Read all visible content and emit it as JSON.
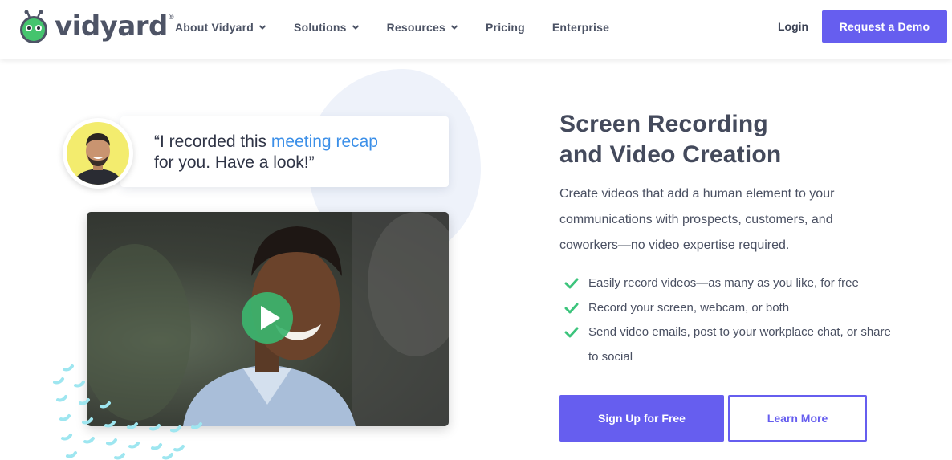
{
  "header": {
    "logo_text": "vidyard",
    "logo_mark": "®",
    "nav": [
      {
        "label": "About Vidyard",
        "icon": "chevron-down-icon"
      },
      {
        "label": "Solutions",
        "icon": "chevron-down-icon"
      },
      {
        "label": "Resources",
        "icon": "chevron-down-icon"
      },
      {
        "label": "Pricing"
      },
      {
        "label": "Enterprise"
      }
    ],
    "login_label": "Login",
    "demo_label": "Request a Demo"
  },
  "hero": {
    "quote_pre": "“I recorded this ",
    "quote_highlight": "meeting recap",
    "quote_post": "for you. Have a look!”",
    "headline_line1": "Screen Recording",
    "headline_line2": "and Video Creation",
    "description": "Create videos that add a human element to your communications with prospects, customers, and coworkers—no video expertise required.",
    "features": [
      "Easily record videos—as many as you like, for free",
      "Record your screen, webcam, or both",
      "Send video emails, post to your workplace chat, or share to social"
    ],
    "signup_label": "Sign Up for Free",
    "learn_label": "Learn More"
  },
  "colors": {
    "brand": "#665eef",
    "highlight": "#3b8fe8",
    "check": "#3cc47c",
    "logo_green": "#45c46e",
    "text_dark": "#444a5c"
  }
}
